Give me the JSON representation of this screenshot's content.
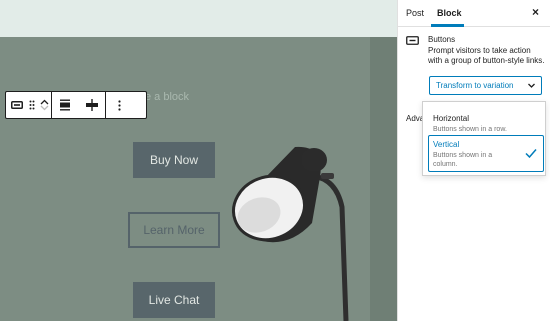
{
  "canvas": {
    "cover_text": "e a block",
    "buttons": [
      "Buy Now",
      "Learn More",
      "Live Chat"
    ]
  },
  "toolbar": {
    "icons": [
      "buttons-block-icon",
      "drag-handle-icon",
      "move-up-icon",
      "move-down-icon",
      "align-icon",
      "justify-icon",
      "more-options-icon"
    ]
  },
  "sidebar": {
    "tabs": {
      "post": "Post",
      "block": "Block"
    },
    "close": "×",
    "block_card": {
      "title": "Buttons",
      "description": "Prompt visitors to take action with a group of button-style links."
    },
    "transform_label": "Transform to variation",
    "advanced_label": "Adva",
    "variations": [
      {
        "title": "Horizontal",
        "description": "Buttons shown in a row."
      },
      {
        "title": "Vertical",
        "description": "Buttons shown in a column.",
        "selected": true
      }
    ]
  },
  "colors": {
    "accent": "#007cba",
    "cover_bg": "#7d8d83",
    "button_bg": "#58666b"
  }
}
